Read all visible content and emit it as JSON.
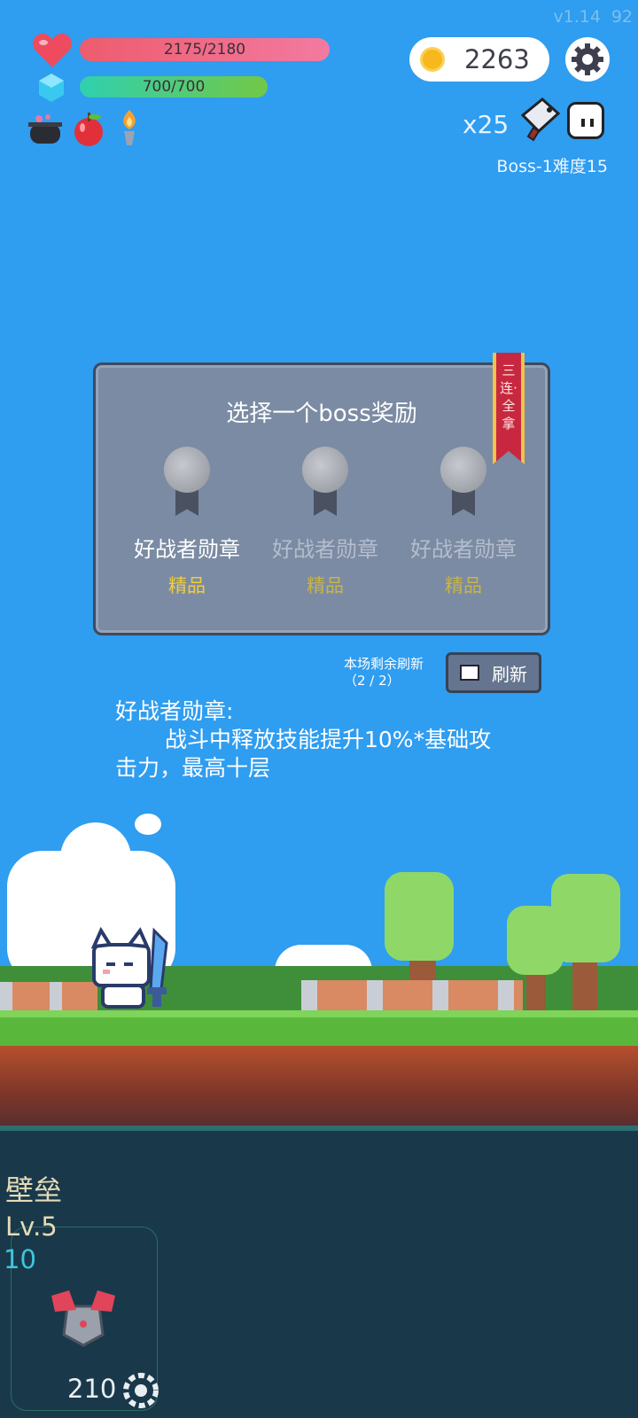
{
  "hud": {
    "version": "v1.14",
    "fps": "92",
    "hp": "2175/2180",
    "hp_fraction": 0.998,
    "mp": "700/700",
    "mp_fraction": 1.0,
    "gold": "2263",
    "boss_count": "x25",
    "boss_level": "Boss-1难度15",
    "buff_icons": [
      "cauldron-icon",
      "apple-icon",
      "torch-icon"
    ]
  },
  "reward_panel": {
    "title": "选择一个boss奖励",
    "ribbon": "三连·全拿",
    "rewards": [
      {
        "name": "好战者勋章",
        "grade": "精品"
      },
      {
        "name": "好战者勋章",
        "grade": "精品"
      },
      {
        "name": "好战者勋章",
        "grade": "精品"
      }
    ],
    "refresh_note_line1": "本场剩余刷新",
    "refresh_note_line2": "（2 / 2）",
    "refresh_button": "刷新"
  },
  "description": {
    "title": "好战者勋章:",
    "body_line1": "战斗中释放技能提升10%*基础攻",
    "body_line2": "击力，最高十层"
  },
  "skill": {
    "name": "壁垒",
    "level": "Lv.5",
    "value": "10",
    "cost": "210"
  },
  "colors": {
    "sky": "#2f9df0",
    "hp": "#ee5c6e",
    "mp": "#2fd0b0",
    "panel": "#7b8ba3",
    "grade": "#f2cd3c"
  }
}
